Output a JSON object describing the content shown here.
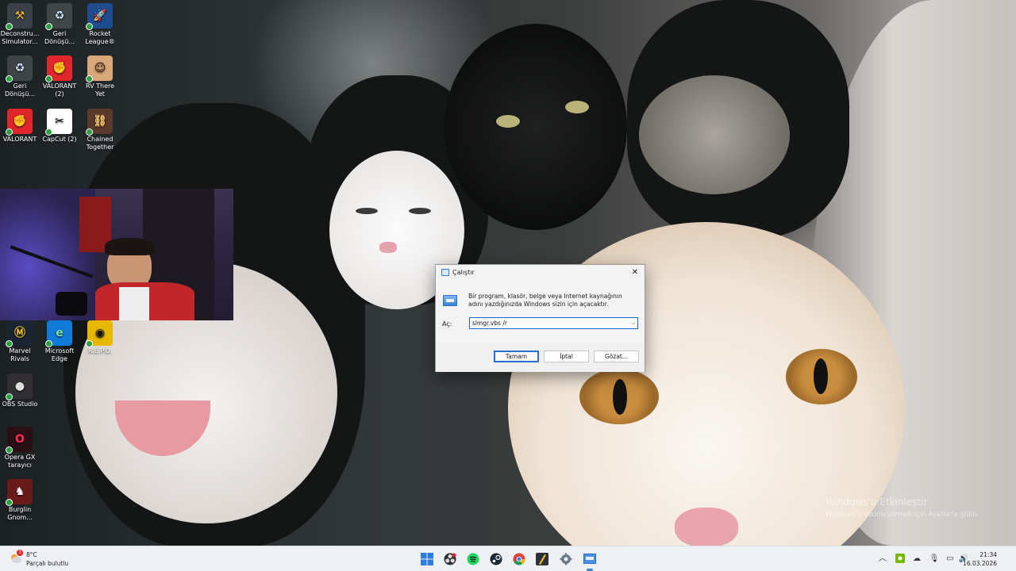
{
  "desktop_icons": [
    {
      "label": "Deconstru... Simulator...",
      "icon": "deconstruction-simulator-icon"
    },
    {
      "label": "Geri Dönüşü...",
      "icon": "recycle-bin-icon"
    },
    {
      "label": "Rocket League®",
      "icon": "rocket-league-icon"
    },
    {
      "label": "Geri Dönüşü...",
      "icon": "recycle-bin-icon"
    },
    {
      "label": "VALORANT (2)",
      "icon": "valorant-icon"
    },
    {
      "label": "RV There Yet",
      "icon": "rv-there-yet-icon"
    },
    {
      "label": "VALORANT",
      "icon": "valorant-icon"
    },
    {
      "label": "CapCut (2)",
      "icon": "capcut-icon"
    },
    {
      "label": "Chained Together",
      "icon": "chained-together-icon"
    },
    {
      "label": "Marvel Rivals",
      "icon": "marvel-rivals-icon"
    },
    {
      "label": "Microsoft Edge",
      "icon": "edge-icon"
    },
    {
      "label": "R.E.P.O.",
      "icon": "repo-icon"
    },
    {
      "label": "OBS Studio",
      "icon": "obs-icon"
    },
    {
      "label": "Opera GX tarayıcı",
      "icon": "opera-gx-icon"
    },
    {
      "label": "Burglin Gnom...",
      "icon": "burglin-gnomes-icon"
    }
  ],
  "run_dialog": {
    "title": "Çalıştır",
    "description": "Bir program, klasör, belge veya Internet kaynağının adını yazdığınızda Windows sizin için açacaktır.",
    "open_label": "Aç:",
    "input_value": "slmgr.vbs /r",
    "ok_label": "Tamam",
    "cancel_label": "İptal",
    "browse_label": "Gözat..."
  },
  "activation": {
    "title": "Windows'u Etkinleştir",
    "subtitle": "Windows'u etkinleştirmek için Ayarlar'a gidin."
  },
  "taskbar": {
    "weather_temp": "8°C",
    "weather_desc": "Parçalı bulutlu",
    "weather_alert": "3",
    "apps": [
      "start-icon",
      "obs-icon",
      "spotify-icon",
      "steam-icon",
      "chrome-icon",
      "deconstruction-simulator-icon",
      "settings-icon",
      "run-icon"
    ],
    "time": "21:34",
    "date": "16.03.2026"
  },
  "colors": {
    "accent": "#2a6fc9",
    "taskbar_bg": "#eef0f3",
    "dialog_bg": "#f3f3f3"
  }
}
